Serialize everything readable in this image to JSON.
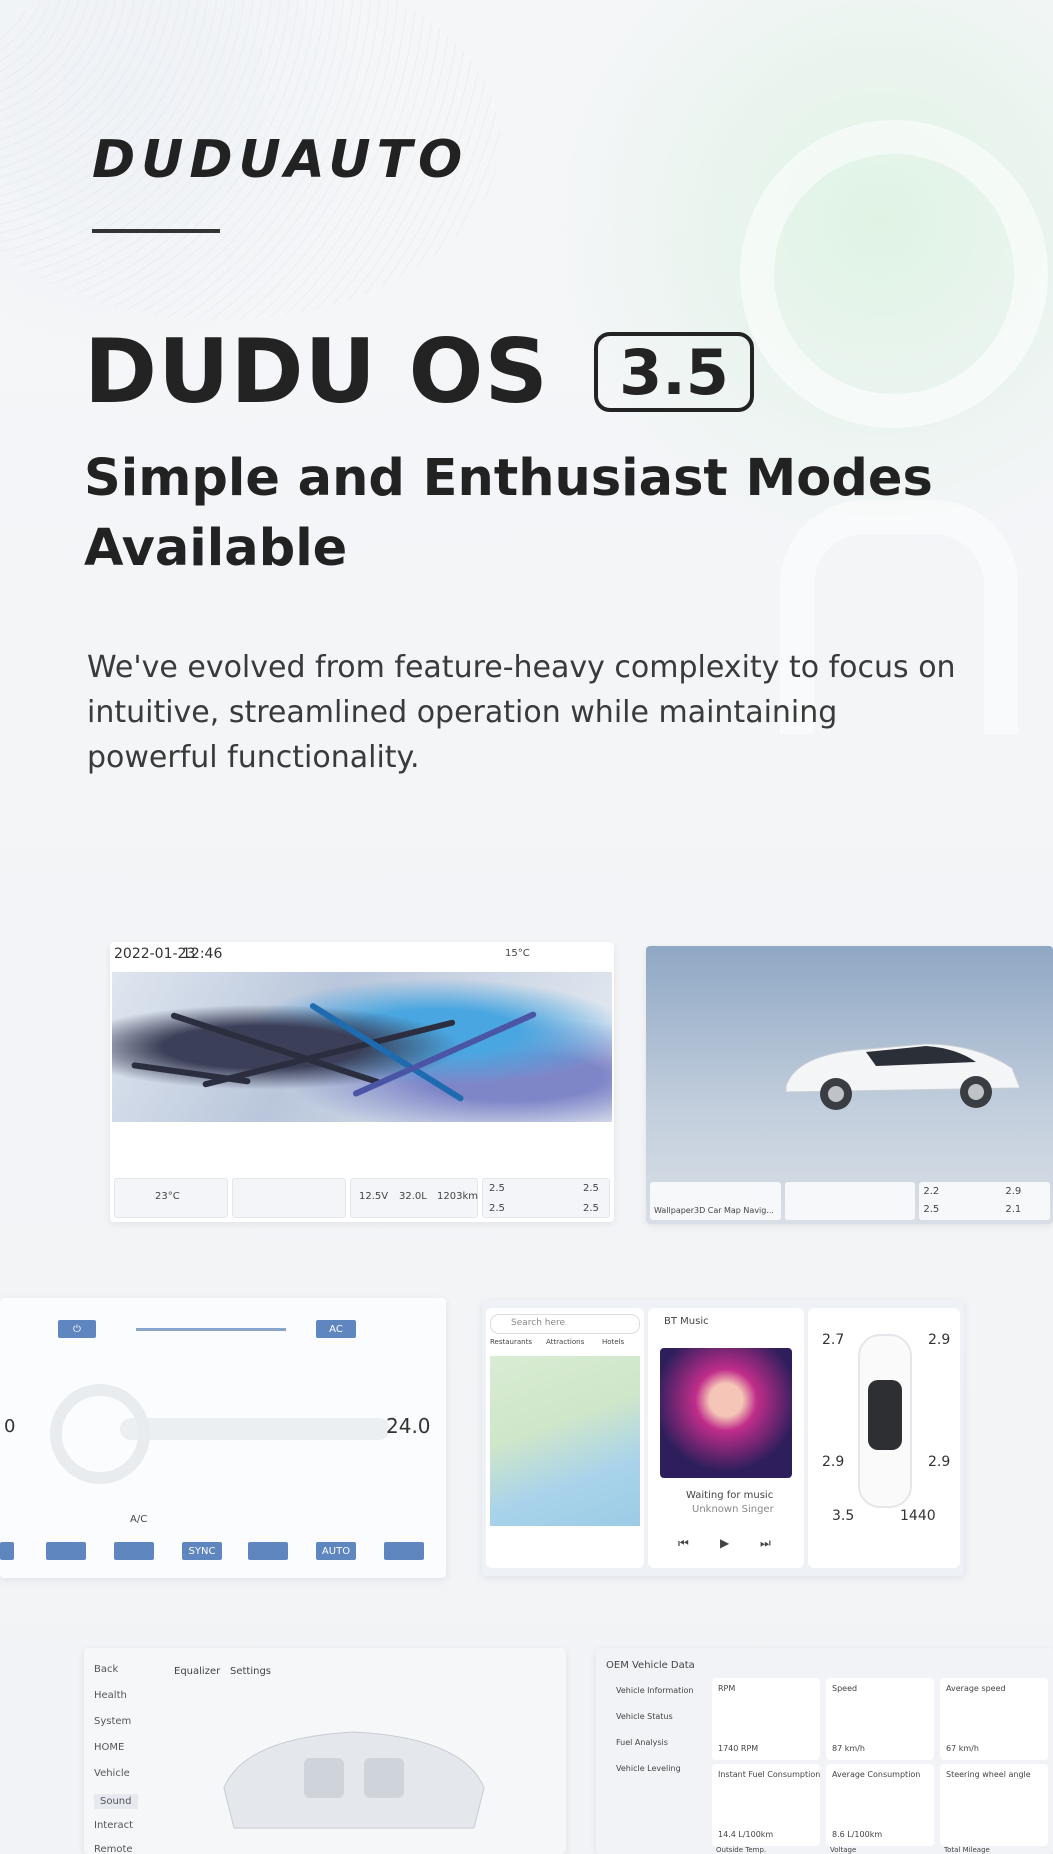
{
  "brand": {
    "logo": "DUDUAUTO"
  },
  "hero": {
    "title": "DUDU OS",
    "version": "3.5",
    "subtitle": "Simple and Enthusiast Modes Available",
    "description": "We've evolved from feature-heavy complexity to focus on intuitive, streamlined operation while maintaining powerful functionality."
  },
  "screen1": {
    "date": "2022-01-23",
    "time": "12:46",
    "temp": "15°C",
    "weather_temp": "23°C",
    "stats": [
      "12.5V",
      "32.0L",
      "1203km"
    ],
    "tire_left_top": "2.5",
    "tire_left_bottom": "2.5",
    "tire_right_top": "2.5",
    "tire_right_bottom": "2.5"
  },
  "screen2": {
    "dock_labels": [
      "Wallpaper",
      "3D Car",
      "Map Navig..."
    ],
    "tire_fl": "2.2",
    "tire_rl": "2.5",
    "tire_fr": "2.9",
    "tire_rr": "2.1"
  },
  "screen3": {
    "power_label": "⏻",
    "ac_label": "AC",
    "temp": "24.0",
    "left_temp_fragment": "0",
    "ac_mode": "A/C",
    "sync_label": "SYNC",
    "auto_label": "AUTO"
  },
  "screen4": {
    "search_placeholder": "Search here",
    "chips": [
      "Restaurants",
      "Attractions",
      "Hotels"
    ],
    "music_title": "BT Music",
    "waiting": "Waiting for music",
    "singer": "Unknown Singer",
    "tire_fl": "2.7",
    "tire_fr": "2.9",
    "tire_rl": "2.9",
    "tire_rr": "2.9",
    "voltage": "3.5",
    "rpm": "1440"
  },
  "screen5": {
    "back": "Back",
    "tabs": [
      "Equalizer",
      "Settings"
    ],
    "menu": [
      "Health",
      "System",
      "HOME",
      "Vehicle",
      "Sound",
      "Interact",
      "Remote"
    ]
  },
  "screen6": {
    "header": "OEM Vehicle Data",
    "menu": [
      "Vehicle Information",
      "Vehicle Status",
      "Fuel Analysis",
      "Vehicle Leveling"
    ],
    "cards": [
      {
        "label": "RPM",
        "value": "1740 RPM"
      },
      {
        "label": "Speed",
        "value": "87 km/h"
      },
      {
        "label": "Average speed",
        "value": "67 km/h"
      },
      {
        "label": "Instant Fuel Consumption",
        "value": "14.4 L/100km"
      },
      {
        "label": "Average Consumption",
        "value": "8.6 L/100km"
      },
      {
        "label": "Steering wheel angle",
        "value": ""
      }
    ],
    "footer": [
      "Outside Temp.",
      "Voltage",
      "Total Mileage"
    ]
  }
}
